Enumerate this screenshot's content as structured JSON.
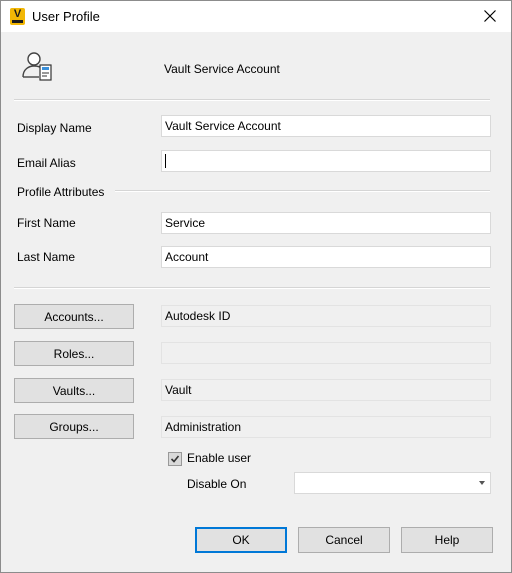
{
  "window": {
    "title": "User Profile"
  },
  "header": {
    "name": "Vault Service Account"
  },
  "fields": {
    "display_name_label": "Display Name",
    "display_name_value": "Vault Service Account",
    "email_alias_label": "Email Alias",
    "email_alias_value": "",
    "profile_attributes_label": "Profile Attributes",
    "first_name_label": "First Name",
    "first_name_value": "Service",
    "last_name_label": "Last Name",
    "last_name_value": "Account"
  },
  "assignments": {
    "accounts_button": "Accounts...",
    "accounts_value": "Autodesk ID",
    "roles_button": "Roles...",
    "roles_value": "",
    "vaults_button": "Vaults...",
    "vaults_value": "Vault",
    "groups_button": "Groups...",
    "groups_value": "Administration"
  },
  "status": {
    "enable_user_label": "Enable user",
    "enable_user_checked": true,
    "disable_on_label": "Disable On",
    "disable_on_value": ""
  },
  "footer": {
    "ok_label": "OK",
    "cancel_label": "Cancel",
    "help_label": "Help"
  },
  "colors": {
    "accent": "#0078d7",
    "app_icon": "#f2b705",
    "window_bg": "#f0f0f0"
  }
}
